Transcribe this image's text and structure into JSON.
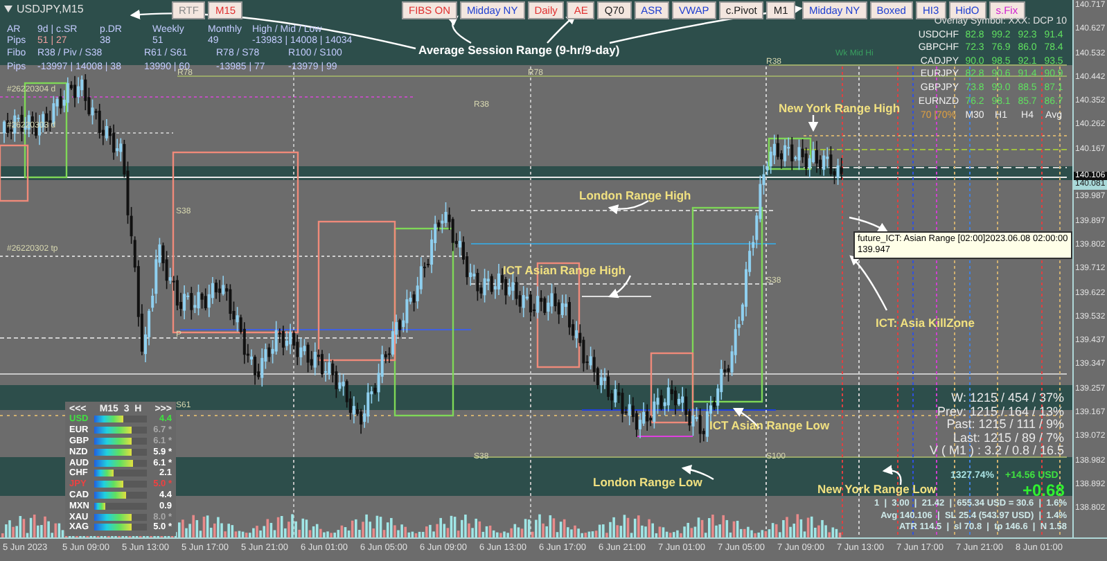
{
  "chart_window": {
    "symbol": "USDJPY,M15"
  },
  "toolbar_left": [
    {
      "label": "RTF",
      "color": "#8a8a8a"
    },
    {
      "label": "M15",
      "color": "#e03030"
    }
  ],
  "toolbar_main": [
    {
      "label": "FIBS ON",
      "color": "#e03030"
    },
    {
      "label": "Midday NY",
      "color": "#2040d0"
    },
    {
      "label": "Daily",
      "color": "#e03030"
    },
    {
      "label": "AE",
      "color": "#e03030"
    },
    {
      "label": "Q70",
      "color": "#202020"
    },
    {
      "label": "ASR",
      "color": "#2040d0"
    },
    {
      "label": "VWAP",
      "color": "#2040d0"
    },
    {
      "label": "c.Pivot",
      "color": "#202020"
    },
    {
      "label": "M1",
      "color": "#202020"
    }
  ],
  "toolbar_right": [
    {
      "label": "Midday NY",
      "color": "#2040d0"
    },
    {
      "label": "Boxed",
      "color": "#2040d0"
    },
    {
      "label": "HI3",
      "color": "#2040d0"
    },
    {
      "label": "HidO",
      "color": "#2040d0"
    },
    {
      "label": "s.Fix",
      "color": "#d020d0"
    }
  ],
  "range_panel": {
    "rows": [
      [
        "AR",
        "9d | c.SR",
        "p.DR",
        "Weekly",
        "Monthly",
        "High / Mid / Low"
      ],
      [
        "Pips",
        "51 | 27",
        "38",
        "51",
        "49",
        "-13983 | 14008 | 14034"
      ],
      [
        "Fibo",
        "R38 / Piv / S38",
        "R61 / S61",
        "R78 / S78",
        "R100 / S100"
      ],
      [
        "Pips",
        "-13997 | 14008 | 38",
        "13990 | 60",
        "-13985 | 77",
        "-13979 | 99"
      ]
    ]
  },
  "level_labels": [
    "#26220304 d",
    "#26220303 d",
    "#26220302 tp",
    "R78",
    "R78",
    "R38",
    "S38",
    "P",
    "S61",
    "S38",
    "R38",
    "Wk Mid Hi",
    "S38",
    "S100"
  ],
  "annotations": [
    {
      "text": "Average Session Range (9-hr/9-day)",
      "color": "#ffffff"
    },
    {
      "text": "New York Range High",
      "color": "#f0e080"
    },
    {
      "text": "London Range High",
      "color": "#f0e080"
    },
    {
      "text": "ICT Asian Range High",
      "color": "#f0e080"
    },
    {
      "text": "ICT: Asia KillZone",
      "color": "#f0e080"
    },
    {
      "text": "ICT Asian Range Low",
      "color": "#f0e080"
    },
    {
      "text": "London Range Low",
      "color": "#f0e080"
    },
    {
      "text": "New York Range Low",
      "color": "#f0e080"
    }
  ],
  "tooltip": {
    "lines": [
      "future_ICT: Asian Range [02:00]2023.06.08 02:00:00",
      "139.947"
    ]
  },
  "overlay_table": {
    "title": "Overlay Symbol: XXX: DCP 10",
    "rows": [
      {
        "symbol": "USDCHF",
        "values": [
          "82.8",
          "99.2",
          "92.3",
          "91.4"
        ]
      },
      {
        "symbol": "GBPCHF",
        "values": [
          "72.3",
          "76.9",
          "86.0",
          "78.4"
        ]
      },
      {
        "symbol": "CADJPY",
        "values": [
          "90.0",
          "98.5",
          "92.1",
          "93.5"
        ]
      },
      {
        "symbol": "EURJPY",
        "values": [
          "82.8",
          "90.6",
          "91.4",
          "90.9"
        ]
      },
      {
        "symbol": "GBPJPY",
        "values": [
          "73.8",
          "99.0",
          "88.5",
          "87.1"
        ]
      },
      {
        "symbol": "EURNZD",
        "values": [
          "76.2",
          "98.1",
          "85.7",
          "86.7"
        ]
      }
    ],
    "footer": [
      "70 |70%",
      "M30",
      "H1",
      "H4",
      "Avg"
    ]
  },
  "strength_panel": {
    "header": [
      "<<<",
      "M15  3  H",
      ">>>"
    ],
    "rows": [
      {
        "currency": "USD",
        "color": "#40e040",
        "level": 0.55,
        "value": "4.4",
        "dimmed": false
      },
      {
        "currency": "EUR",
        "color": "#ffffff",
        "level": 0.72,
        "value": "6.7 *",
        "dimmed": true
      },
      {
        "currency": "GBP",
        "color": "#ffffff",
        "level": 0.7,
        "value": "6.1 *",
        "dimmed": true
      },
      {
        "currency": "NZD",
        "color": "#ffffff",
        "level": 0.7,
        "value": "5.9 *",
        "dimmed": false
      },
      {
        "currency": "AUD",
        "color": "#ffffff",
        "level": 0.74,
        "value": "6.1 *",
        "dimmed": false
      },
      {
        "currency": "CHF",
        "color": "#ffffff",
        "level": 0.36,
        "value": "2.1",
        "dimmed": false
      },
      {
        "currency": "JPY",
        "color": "#f04040",
        "level": 0.56,
        "value": "5.0 *",
        "dimmed": false
      },
      {
        "currency": "CAD",
        "color": "#ffffff",
        "level": 0.6,
        "value": "4.4",
        "dimmed": false
      },
      {
        "currency": "MXN",
        "color": "#ffffff",
        "level": 0.2,
        "value": "0.9",
        "dimmed": false
      },
      {
        "currency": "XAU",
        "color": "#ffffff",
        "level": 0.72,
        "value": "8.0 *",
        "dimmed": true
      },
      {
        "currency": "XAG",
        "color": "#ffffff",
        "level": 0.72,
        "value": "5.0 *",
        "dimmed": false
      }
    ]
  },
  "stats": {
    "lines": [
      "W: 1215 / 454 / 37%",
      "Prev: 1215 / 164 / 13%",
      "Past: 1215 / 111 / 9%",
      "Last: 1215 / 89 / 7%",
      "V ( M1 ) : 3.2 / 0.8 / 16.5"
    ],
    "percent": "1327.74%",
    "profit": "+14.56 USD",
    "pips": "+0.68",
    "trade_lines": [
      "1  |  3.00  |  21.42  |  655.34 USD = 30.6  |  1.6%",
      "Avg 140.106  |  SL 25.4 (543.97 USD)  |  1.4%",
      "ATR 114.5  |  sl 70.8  |  tp 146.6  |  N 1.58"
    ]
  },
  "price_axis": {
    "labels": [
      "140.717",
      "140.627",
      "140.532",
      "140.442",
      "140.352",
      "140.262",
      "140.167",
      "139.987",
      "139.897",
      "139.802",
      "139.712",
      "139.622",
      "139.532",
      "139.437",
      "139.347",
      "139.257",
      "139.167",
      "139.072",
      "138.982",
      "138.892",
      "138.802"
    ],
    "current_prices": [
      "140.106",
      "140.081"
    ]
  },
  "time_axis": {
    "labels": [
      "5 Jun 2023",
      "5 Jun 09:00",
      "5 Jun 13:00",
      "5 Jun 17:00",
      "5 Jun 21:00",
      "6 Jun 01:00",
      "6 Jun 05:00",
      "6 Jun 09:00",
      "6 Jun 13:00",
      "6 Jun 17:00",
      "6 Jun 21:00",
      "7 Jun 01:00",
      "7 Jun 05:00",
      "7 Jun 09:00",
      "7 Jun 13:00",
      "7 Jun 17:00",
      "7 Jun 21:00",
      "8 Jun 01:00"
    ]
  }
}
